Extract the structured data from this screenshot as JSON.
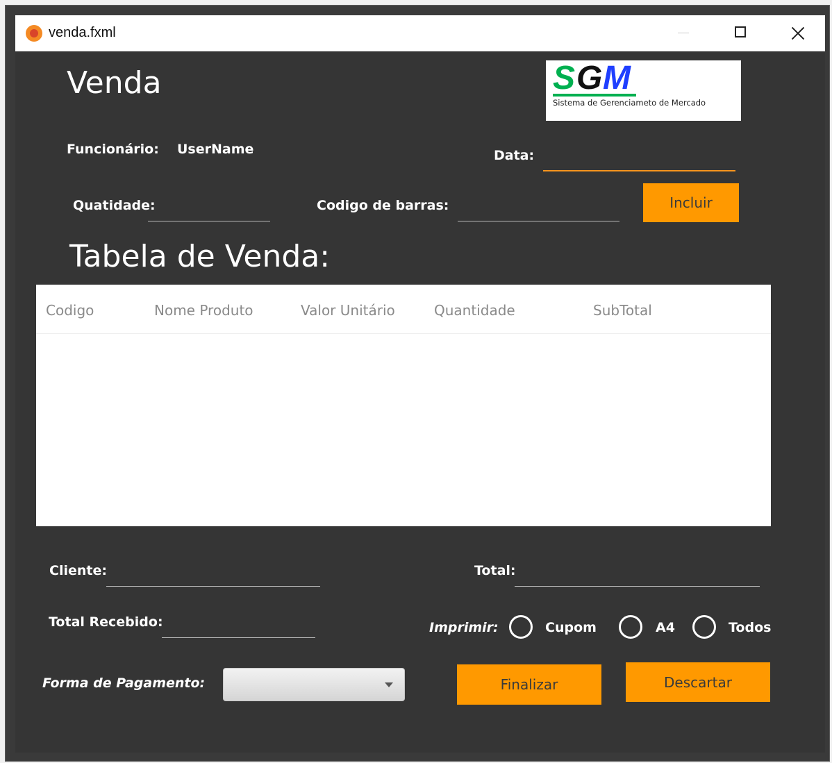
{
  "window": {
    "title": "venda.fxml"
  },
  "header": {
    "title": "Venda"
  },
  "logo": {
    "letters": [
      "S",
      "G",
      "M"
    ],
    "subtitle": "Sistema de Gerenciameto de Mercado"
  },
  "form": {
    "funcionario_label": "Funcionário:",
    "funcionario_value": "UserName",
    "data_label": "Data:",
    "data_value": "",
    "quantidade_label": "Quatidade:",
    "quantidade_value": "",
    "codigo_label": "Codigo de barras:",
    "codigo_value": "",
    "incluir_label": "Incluir"
  },
  "table": {
    "title": "Tabela de Venda:",
    "columns": [
      "Codigo",
      "Nome Produto",
      "Valor Unitário",
      "Quantidade",
      "SubTotal"
    ],
    "rows": []
  },
  "footer": {
    "cliente_label": "Cliente:",
    "cliente_value": "",
    "total_label": "Total:",
    "total_value": "",
    "total_recebido_label": "Total Recebido:",
    "total_recebido_value": "",
    "imprimir_label": "Imprimir:",
    "print_options": [
      "Cupom",
      "A4",
      "Todos"
    ],
    "forma_pagamento_label": "Forma de Pagamento:",
    "forma_pagamento_value": "",
    "finalizar_label": "Finalizar",
    "descartar_label": "Descartar"
  },
  "colors": {
    "accent": "#ff9900",
    "background": "#353535",
    "table_bg": "#ffffff"
  }
}
